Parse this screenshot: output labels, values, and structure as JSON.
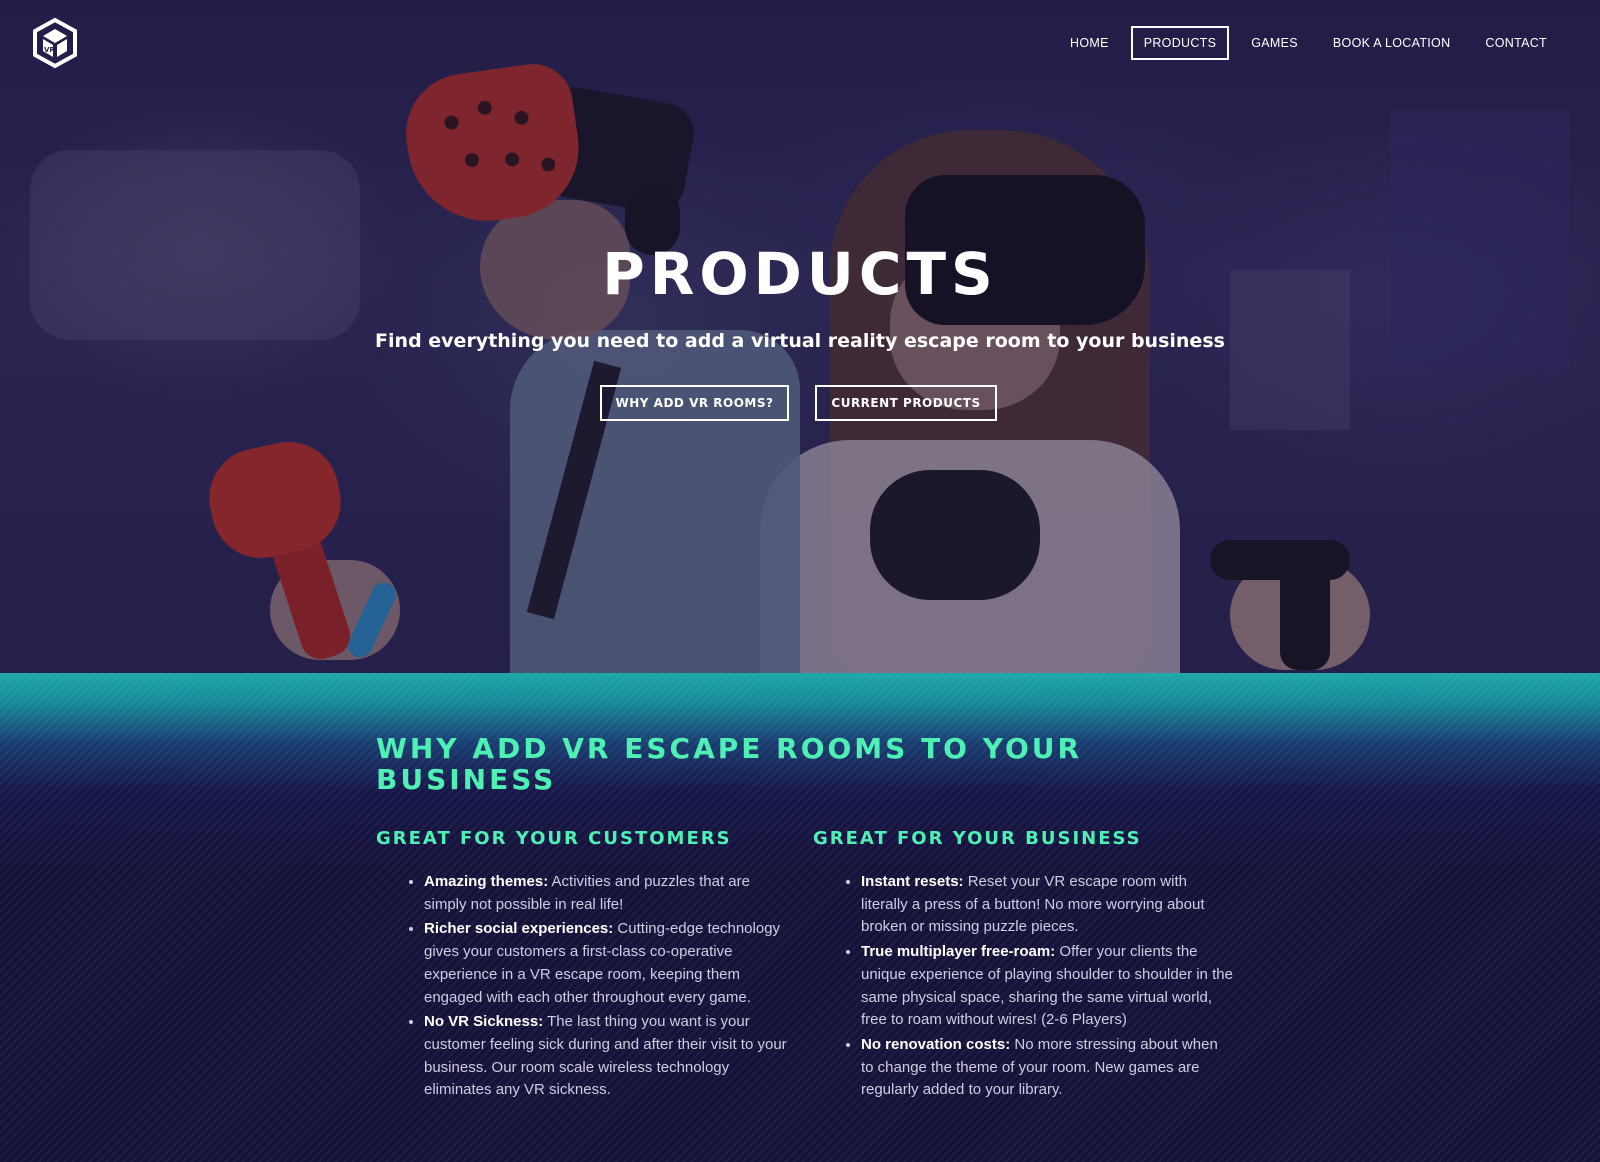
{
  "brand": {
    "logo_icon": "vr-cube-logo-icon"
  },
  "nav": {
    "items": [
      {
        "label": "HOME",
        "active": false
      },
      {
        "label": "PRODUCTS",
        "active": true
      },
      {
        "label": "GAMES",
        "active": false
      },
      {
        "label": "BOOK A LOCATION",
        "active": false
      },
      {
        "label": "CONTACT",
        "active": false
      }
    ]
  },
  "hero": {
    "title": "PRODUCTS",
    "subtitle": "Find everything you need to add a virtual reality escape room to your business",
    "buttons": [
      {
        "label": "WHY ADD VR ROOMS?"
      },
      {
        "label": "CURRENT PRODUCTS"
      }
    ]
  },
  "section": {
    "heading": "WHY ADD VR ESCAPE ROOMS TO YOUR BUSINESS",
    "columns": [
      {
        "heading": "GREAT FOR YOUR CUSTOMERS",
        "items": [
          {
            "title": "Amazing themes:",
            "text": " Activities and puzzles that are simply not possible in real life!"
          },
          {
            "title": "Richer social experiences:",
            "text": " Cutting-edge technology gives your customers a first-class co-operative experience in a VR escape room, keeping them engaged with each other throughout every game."
          },
          {
            "title": "No VR Sickness:",
            "text": " The last thing you want is your customer feeling sick during and after their visit to your business. Our room scale wireless technology eliminates any VR sickness."
          }
        ]
      },
      {
        "heading": "GREAT FOR YOUR BUSINESS",
        "items": [
          {
            "title": "Instant resets:",
            "text": " Reset your VR escape room with literally a press of a button! No more worrying about broken or missing puzzle pieces."
          },
          {
            "title": "True multiplayer free-roam:",
            "text": " Offer your clients the unique experience of playing shoulder to shoulder in the same physical space, sharing the same virtual world, free to roam without wires! (2-6 Players)"
          },
          {
            "title": "No renovation costs:",
            "text": " No more stressing about when to change the theme of your room. New games are regularly added to your library."
          }
        ]
      }
    ]
  },
  "colors": {
    "accent": "#4ef0b4",
    "background": "#15133a",
    "teal_band": "#1da8a8"
  }
}
